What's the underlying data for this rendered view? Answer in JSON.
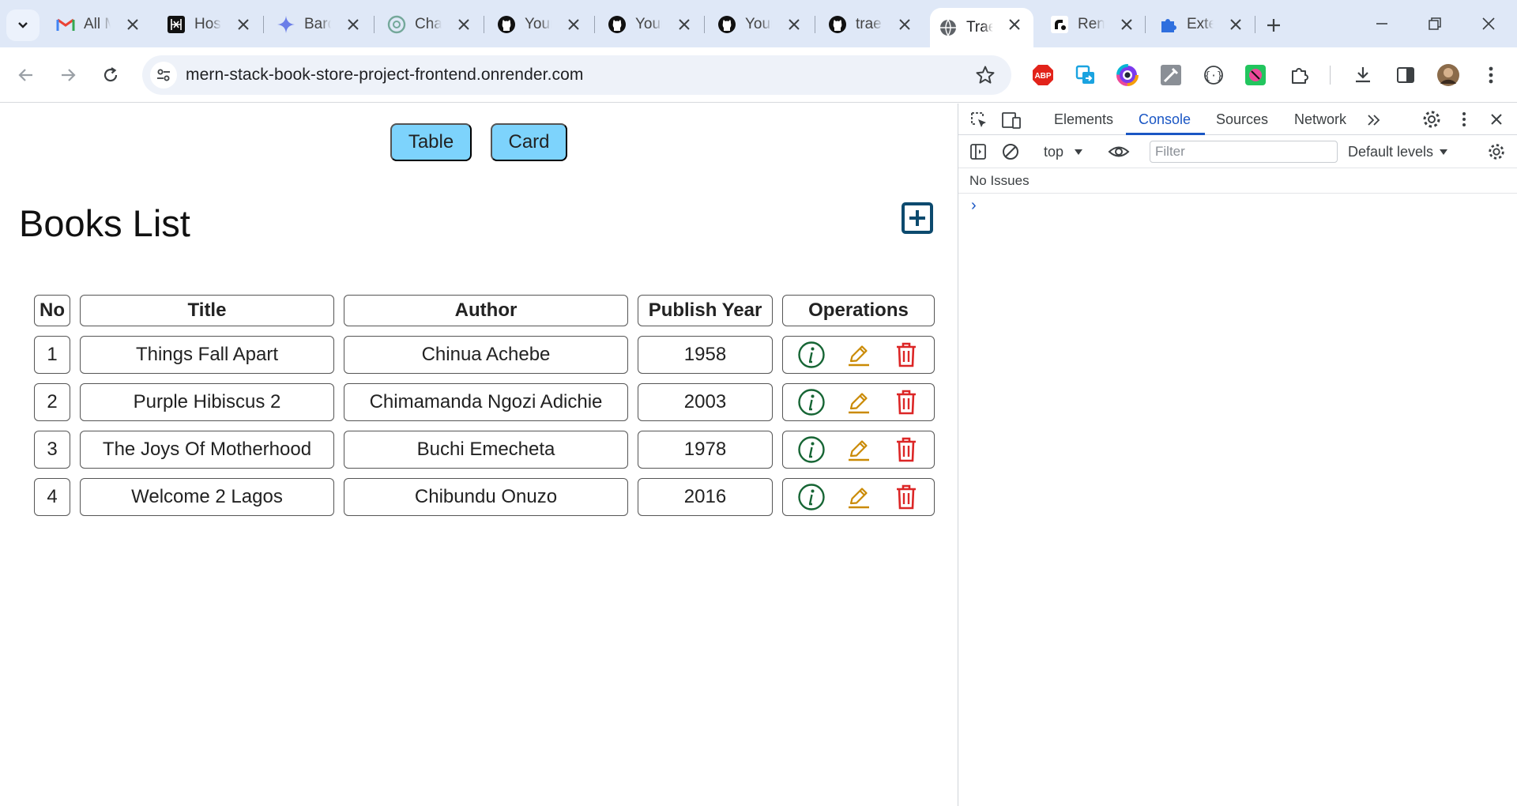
{
  "browser": {
    "tabs": [
      {
        "label": "All M",
        "icon": "gmail-icon"
      },
      {
        "label": "Host",
        "icon": "hostinger-icon"
      },
      {
        "label": "Bard",
        "icon": "bard-icon"
      },
      {
        "label": "Chat",
        "icon": "chatgpt-icon"
      },
      {
        "label": "Your",
        "icon": "github-icon"
      },
      {
        "label": "Your",
        "icon": "github-icon"
      },
      {
        "label": "Your",
        "icon": "github-icon"
      },
      {
        "label": "trae",
        "icon": "github-icon"
      },
      {
        "label": "Trae",
        "icon": "globe-icon",
        "active": true
      },
      {
        "label": "Ren",
        "icon": "render-icon"
      },
      {
        "label": "Exte",
        "icon": "extensions-icon"
      }
    ],
    "url": "mern-stack-book-store-project-frontend.onrender.com"
  },
  "page": {
    "view_buttons": {
      "table": "Table",
      "card": "Card"
    },
    "title": "Books List",
    "table": {
      "headers": [
        "No",
        "Title",
        "Author",
        "Publish Year",
        "Operations"
      ],
      "rows": [
        {
          "no": "1",
          "title": "Things Fall Apart",
          "author": "Chinua Achebe",
          "year": "1958"
        },
        {
          "no": "2",
          "title": "Purple Hibiscus 2",
          "author": "Chimamanda Ngozi Adichie",
          "year": "2003"
        },
        {
          "no": "3",
          "title": "The Joys Of Motherhood",
          "author": "Buchi Emecheta",
          "year": "1978"
        },
        {
          "no": "4",
          "title": "Welcome 2 Lagos",
          "author": "Chibundu Onuzo",
          "year": "2016"
        }
      ]
    },
    "colors": {
      "button": "#7dd3fc",
      "info": "#166534",
      "edit": "#ca8a04",
      "delete": "#dc2626",
      "add": "#0c4a6e"
    }
  },
  "devtools": {
    "tabs": [
      "Elements",
      "Console",
      "Sources",
      "Network"
    ],
    "active_tab": "Console",
    "context": "top",
    "filter_placeholder": "Filter",
    "levels": "Default levels",
    "issues": "No Issues",
    "prompt": "›"
  }
}
